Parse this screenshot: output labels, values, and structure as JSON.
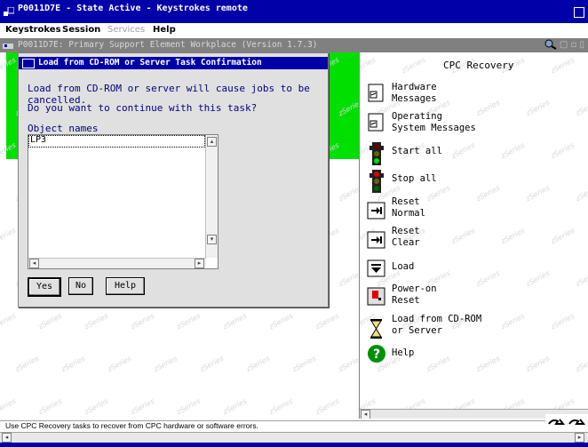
{
  "window": {
    "title": "P0011D7E - State Active - Keystrokes remote"
  },
  "menubar": {
    "items": [
      {
        "label": "Keystrokes",
        "enabled": true
      },
      {
        "label": "Session",
        "enabled": true
      },
      {
        "label": "Services",
        "enabled": false
      },
      {
        "label": "Help",
        "enabled": true
      }
    ]
  },
  "workplace": {
    "title": "P0011D7E: Primary Support Element Workplace (Version 1.7.3)",
    "watermark": "zSeries"
  },
  "dialog": {
    "title": "Load from CD-ROM or Server Task Confirmation",
    "message": "Load from CD-ROM or server will cause jobs to be cancelled.",
    "question": "Do you want to continue with this task?",
    "list_label": "Object names",
    "objects": [
      "LP3"
    ],
    "buttons": {
      "yes": "Yes",
      "no": "No",
      "help": "Help"
    }
  },
  "panel": {
    "title": "CPC Recovery",
    "tasks": [
      {
        "line1": "Hardware",
        "line2": "Messages",
        "icon": "hardware-messages-icon"
      },
      {
        "line1": "Operating",
        "line2": "System Messages",
        "icon": "os-messages-icon"
      },
      {
        "line1": "Start all",
        "line2": "",
        "icon": "traffic-light-green-icon"
      },
      {
        "line1": "Stop all",
        "line2": "",
        "icon": "traffic-light-red-icon"
      },
      {
        "line1": "Reset",
        "line2": "Normal",
        "icon": "reset-normal-icon"
      },
      {
        "line1": "Reset",
        "line2": "Clear",
        "icon": "reset-clear-icon"
      },
      {
        "line1": "Load",
        "line2": "",
        "icon": "load-icon"
      },
      {
        "line1": "Power-on",
        "line2": "Reset",
        "icon": "power-on-reset-icon"
      },
      {
        "line1": "Load from CD-ROM",
        "line2": "or Server",
        "icon": "hourglass-icon"
      },
      {
        "line1": "Help",
        "line2": "",
        "icon": "help-icon"
      }
    ]
  },
  "status": {
    "text": "Use CPC Recovery tasks to recover from CPC hardware or software errors."
  },
  "colors": {
    "title_bar": "#0000a8",
    "workplace_green": "#00e000",
    "dialog_text": "#000080"
  }
}
